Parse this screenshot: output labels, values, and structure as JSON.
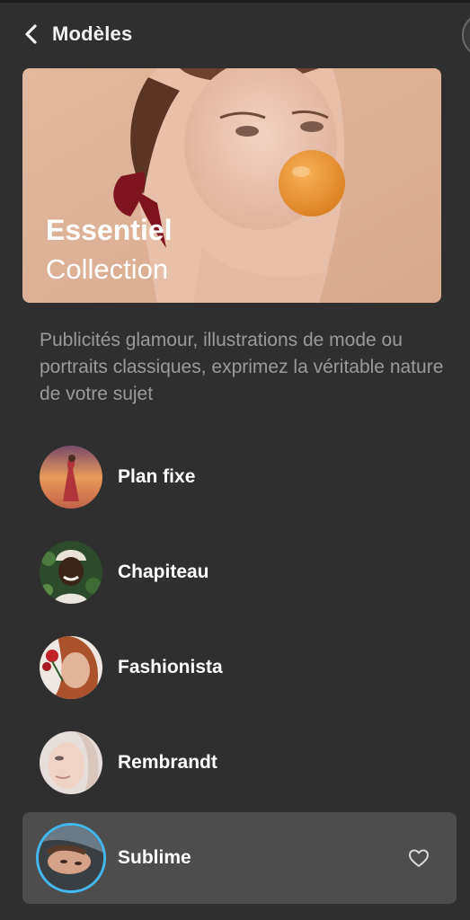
{
  "header": {
    "back_icon": "chevron-left-icon",
    "title": "Modèles"
  },
  "hero": {
    "title": "Essentiel",
    "subtitle": "Collection"
  },
  "description": "Publicités glamour, illustrations de mode ou portraits classiques, exprimez la véritable nature de votre sujet",
  "presets": [
    {
      "label": "Plan fixe",
      "selected": false
    },
    {
      "label": "Chapiteau",
      "selected": false
    },
    {
      "label": "Fashionista",
      "selected": false
    },
    {
      "label": "Rembrandt",
      "selected": false
    },
    {
      "label": "Sublime",
      "selected": true,
      "favorite_icon": "heart-outline-icon"
    }
  ],
  "colors": {
    "background": "#2f2f2f",
    "selected_row": "#4d4d4d",
    "accent_ring": "#43b8f0",
    "description_text": "#9a9a9a"
  }
}
